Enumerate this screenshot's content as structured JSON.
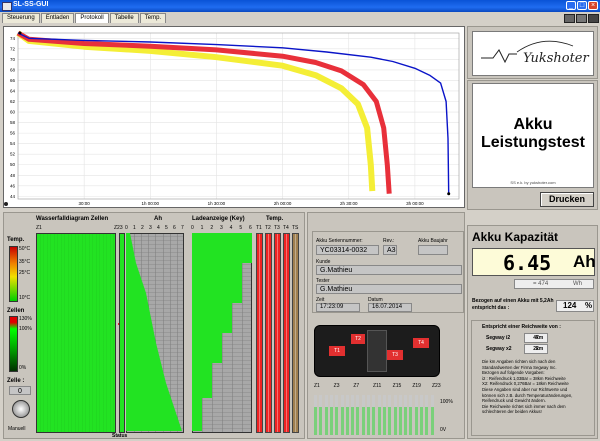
{
  "window": {
    "title": "SL-SS-GUI"
  },
  "tabs": [
    {
      "label": "Steuerung",
      "active": false
    },
    {
      "label": "Entladen",
      "active": false
    },
    {
      "label": "Protokoll",
      "active": true
    },
    {
      "label": "Tabelle",
      "active": false
    },
    {
      "label": "Temp.",
      "active": false
    }
  ],
  "chart_data": {
    "type": "line",
    "x_ticks": [
      "30:00",
      "1h 00:00",
      "1h 30:00",
      "2h 00:00",
      "2h 30:00",
      "3h 00:00"
    ],
    "y_ticks": [
      "74",
      "72",
      "70",
      "68",
      "66",
      "64",
      "62",
      "60",
      "58",
      "56",
      "54",
      "52",
      "50",
      "48",
      "46",
      "44"
    ],
    "ylim": [
      43.5,
      75
    ],
    "xlim": [
      0,
      12000
    ],
    "colors": {
      "blue": "#0a14c8",
      "red": "#e8303a",
      "yellow": "#f4ee36"
    },
    "series": [
      {
        "color": "#0a14c8",
        "points": [
          [
            0,
            75
          ],
          [
            300,
            74
          ],
          [
            1800,
            73.6
          ],
          [
            3600,
            73.3
          ],
          [
            5400,
            72.8
          ],
          [
            7200,
            72.2
          ],
          [
            8400,
            71.4
          ],
          [
            9600,
            70.4
          ],
          [
            10200,
            69.6
          ],
          [
            10800,
            68.3
          ],
          [
            11200,
            67
          ],
          [
            11500,
            65.5
          ],
          [
            11650,
            62
          ],
          [
            11700,
            55
          ],
          [
            11720,
            44.5
          ]
        ]
      },
      {
        "color": "#e8303a",
        "points": [
          [
            0,
            75
          ],
          [
            300,
            73.8
          ],
          [
            1800,
            73
          ],
          [
            3600,
            72.5
          ],
          [
            5400,
            71.8
          ],
          [
            7200,
            70.6
          ],
          [
            8100,
            69.4
          ],
          [
            8800,
            67.8
          ],
          [
            9400,
            65.2
          ],
          [
            9750,
            62
          ],
          [
            9950,
            57
          ],
          [
            10050,
            50
          ],
          [
            10100,
            44.5
          ]
        ]
      },
      {
        "color": "#f4ee36",
        "points": [
          [
            0,
            75
          ],
          [
            300,
            73.5
          ],
          [
            1800,
            72.4
          ],
          [
            3600,
            71.6
          ],
          [
            5400,
            70.4
          ],
          [
            7200,
            68.8
          ],
          [
            8100,
            67
          ],
          [
            8800,
            64.5
          ],
          [
            9250,
            61.5
          ],
          [
            9500,
            57
          ],
          [
            9600,
            50
          ],
          [
            9640,
            45
          ]
        ]
      }
    ]
  },
  "logo": {
    "text": "Yukshoter",
    "url": "SS e.k. by yukshoter.com"
  },
  "report": {
    "title_line1": "Akku",
    "title_line2": "Leistungstest",
    "print_label": "Drucken"
  },
  "waterfall": {
    "title": "Wasserfalldiagram  Zellen",
    "ah_label": "Ah",
    "ladeanzeige_label": "Ladeanzeige (Key)",
    "temp_label": "Temp.",
    "status_label": "Status",
    "z1": "Z1",
    "z23": "Z23",
    "ah_ticks": [
      "0",
      "1",
      "2",
      "3",
      "4",
      "5",
      "6",
      "7"
    ],
    "lade_ticks": [
      "0",
      "1",
      "2",
      "3",
      "4",
      "5",
      "6"
    ],
    "temp_cols": [
      "T1",
      "T2",
      "T3",
      "T4",
      "TS"
    ]
  },
  "legend_temp": {
    "title": "Temp.",
    "ticks": [
      "50°C",
      "35°C",
      "25°C",
      "10°C"
    ]
  },
  "legend_zellen": {
    "title": "Zellen",
    "ticks": [
      "130%",
      "100%",
      "0%"
    ]
  },
  "zelle": {
    "label": "Zelle :",
    "value": "0",
    "manual_label": "Manuell"
  },
  "info": {
    "serial_label": "Akku Seriennummer:",
    "serial": "YC03314-0032",
    "rev_label": "Rev.:",
    "rev": "A3",
    "year_label": "Akku Baujahr",
    "year": "",
    "kunde_label": "Kunde",
    "kunde": "G.Mathieu",
    "tester_label": "Tester",
    "tester": "G.Mathieu",
    "zeit_label": "Zeit",
    "zeit": "17:23:09",
    "datum_label": "Datum",
    "datum": "16.07.2014"
  },
  "capacity": {
    "title": "Akku Kapazität",
    "value": "6.45",
    "unit": "Ah",
    "wh": "= 474",
    "wh_unit": "Wh",
    "bezogen_label": "Bezogen auf einen Akku mit 5,2Ah entspricht das :",
    "percent": "124",
    "percent_unit": "%"
  },
  "range": {
    "title": "Entspricht einer Reichweite von :",
    "rows": [
      {
        "label": "Segway i2",
        "value": "47",
        "unit": "km"
      },
      {
        "label": "Segway x2",
        "value": "22",
        "unit": "km"
      }
    ],
    "notes": [
      "Die km Angaben richten sich nach den",
      "Standardwerten der Firma Segway Inc.",
      "Bezogen auf folgende Vorgaben:",
      "i2 : Reifendruck 1,03Bar = 38km Reichweite",
      "X2: Reifendruck 0,276Bar = 18km Reichweite",
      "Diese Angaben sind aber nur Richtwerte und",
      "können sich z.B. durch Temperaturänderungen,",
      "Reifendruck und Gewicht ändern.",
      "Die Reichweite richtet sich immer nach dem",
      "schlechteren der beiden Akkus!"
    ]
  },
  "battery_image": {
    "sensors": [
      "T1",
      "T2",
      "T3",
      "T4"
    ],
    "cell_ticks": [
      "Z1",
      "Z3",
      "Z7",
      "Z11",
      "Z15",
      "Z19",
      "Z23"
    ],
    "pct_100": "100%",
    "pct_0": "0V"
  }
}
